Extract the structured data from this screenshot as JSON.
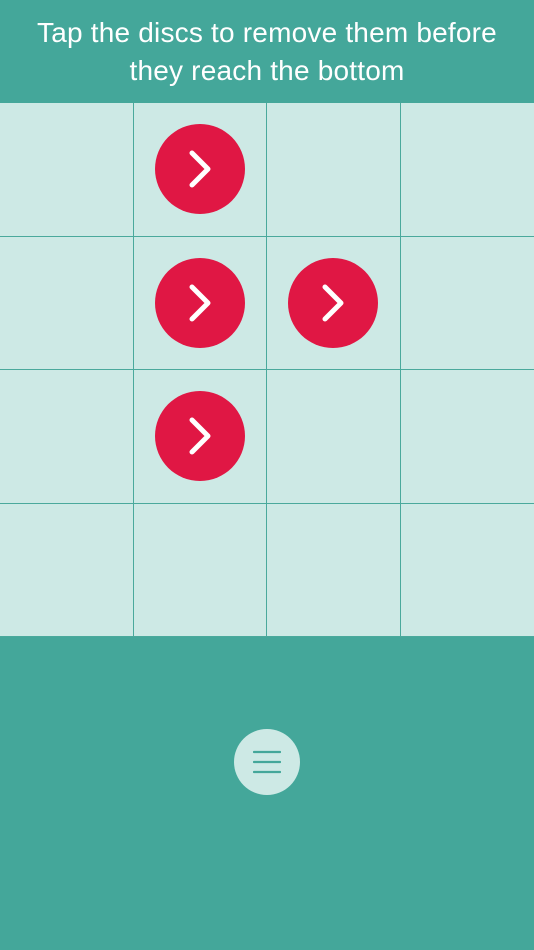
{
  "header": {
    "instruction": "Tap the discs to remove them before they reach the bottom"
  },
  "board": {
    "rows": 4,
    "cols": 4,
    "discs": [
      {
        "row": 1,
        "col": 2,
        "icon": "chevron-right-icon"
      },
      {
        "row": 2,
        "col": 2,
        "icon": "chevron-right-icon"
      },
      {
        "row": 2,
        "col": 3,
        "icon": "chevron-right-icon"
      },
      {
        "row": 3,
        "col": 2,
        "icon": "chevron-right-icon"
      }
    ]
  },
  "menu": {
    "icon": "menu-icon"
  },
  "colors": {
    "background": "#44a79a",
    "board": "#cde9e5",
    "grid_line": "#4aa99c",
    "disc": "#e01744",
    "disc_icon": "#ffffff"
  }
}
